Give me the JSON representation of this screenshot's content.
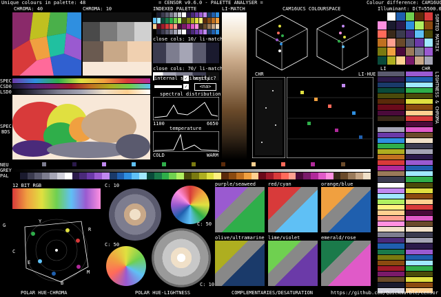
{
  "header": {
    "unique_colours": "Unique colours in palette: 48",
    "title": "= CENSOR v0.6.0 - PALETTE ANALYSER =",
    "colour_difference": "Colour difference: CAM16UCS",
    "illuminant": "Illuminant: D(T=5500.0°K)",
    "chroma_left": "CHROMA: 40",
    "chroma_mid": "CHROMA: 10",
    "indexed_palette": "INDEXED PALETTE",
    "li_match_top": "LI-MATCH",
    "space": "CAM16UCS COLOURSPACE"
  },
  "side_labels": {
    "spec": "SPEC",
    "csd0": "CSD0",
    "lsd0": "LSD0",
    "spec2": "SPEC",
    "bds": "BDS",
    "neu": "NEU",
    "grey": "GREY",
    "pal": "PAL"
  },
  "indexed": {
    "close_cols_1": "close cols: 10/ li-match",
    "close_cols_2": "close cols: 70/ li-match",
    "internal_similarity": "internal similarity",
    "acyclic": "acyclic?",
    "na": "<na>",
    "spectral": "spectral distribution",
    "spec_min": "1100",
    "spec_max": "6650",
    "temperature": "temperature",
    "cold": "COLD",
    "warm": "WARM"
  },
  "mid_right": {
    "chr": "CHR",
    "li_hue": "LI-HUE"
  },
  "far_right": {
    "li": "LI",
    "chr": "CHR",
    "vert1": "SORTED MATRIX",
    "vert2": "LIGHTNESS & CHROMA"
  },
  "bottom": {
    "rgb12": "12 BIT RGB",
    "c10_a": "C: 10",
    "c50_a": "C: 50",
    "c50_b": "C: 50",
    "c10_b": "C: 10",
    "polar_hue_chroma": "POLAR HUE-CHROMA",
    "polar_hue_lightness": "POLAR HUE-LIGHTNESS",
    "complementaries": "COMPLEMENTARIES/DESATURATION",
    "url": "https://github.com/Quickmarble/censor",
    "hex_labels": [
      "G",
      "Y",
      "R",
      "C",
      "E",
      "B",
      "M"
    ],
    "pairs": [
      "purple/seaweed",
      "red/cyan",
      "orange/blue",
      "olive/ultramarine",
      "lime/violet",
      "emerald/rose"
    ]
  },
  "palette": [
    "#000000",
    "#1a1a2e",
    "#3b3b4f",
    "#5a5a6e",
    "#7d7d8f",
    "#a5a5b5",
    "#d0d0da",
    "#ffffff",
    "#2b1a4a",
    "#4a2a7a",
    "#6b3aa8",
    "#9a5ad0",
    "#c088f0",
    "#1a3a6a",
    "#1f5fae",
    "#2f8fe0",
    "#5fc0f5",
    "#a0e8ff",
    "#0a4a3a",
    "#1a7a4a",
    "#2fae4a",
    "#6fd050",
    "#b0f060",
    "#4a4a0a",
    "#7a7a10",
    "#aeae20",
    "#e0e040",
    "#fff080",
    "#5a2a0a",
    "#8a4a10",
    "#c07020",
    "#f0a040",
    "#ffd090",
    "#6a0a1a",
    "#a01a2a",
    "#d83a3a",
    "#ff6a5a",
    "#ffa090",
    "#4a0a3a",
    "#7a1a6a",
    "#b02a9a",
    "#e05ac8",
    "#ff90e0",
    "#3a2a1a",
    "#6a4a2a",
    "#9a7a5a",
    "#c8a888",
    "#f0e0c8"
  ],
  "colors": {
    "bg": "#000000",
    "panel": "#111111",
    "text": "#ffffff",
    "accent": "#ff4060"
  }
}
